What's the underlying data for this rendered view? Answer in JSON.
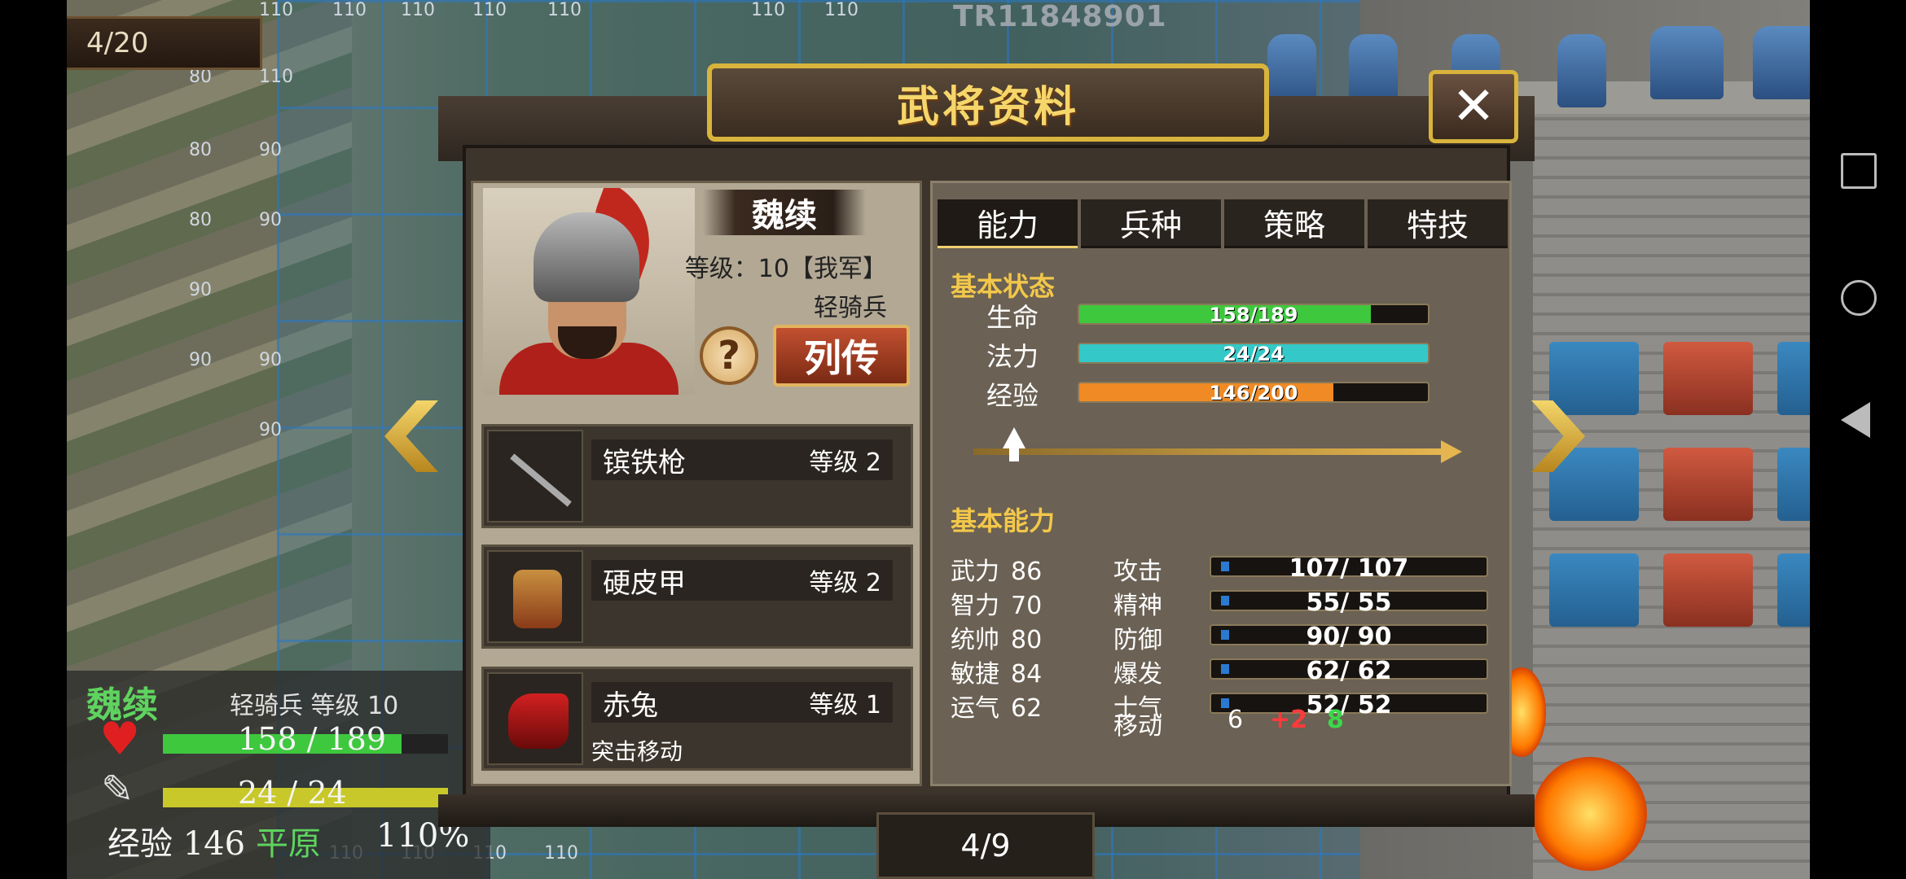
{
  "map": {
    "turn": "4/20",
    "game_id": "TR11848901",
    "grid_costs": [
      "110",
      "110",
      "110",
      "110",
      "110",
      "110",
      "110",
      "80",
      "110",
      "80",
      "90",
      "80",
      "90",
      "90",
      "90",
      "90",
      "90",
      "110",
      "110",
      "110",
      "110"
    ]
  },
  "dialog": {
    "title": "武将资料",
    "close_icon": "close-icon",
    "general": {
      "name": "魏续",
      "level_text": "等级：10【我军】",
      "unit_type": "轻骑兵",
      "help_label": "?",
      "biography_label": "列传"
    },
    "equipment": [
      {
        "name": "镔铁枪",
        "level": "等级 2",
        "note": "",
        "icon": "spear-icon"
      },
      {
        "name": "硬皮甲",
        "level": "等级 2",
        "note": "",
        "icon": "armor-icon"
      },
      {
        "name": "赤兔",
        "level": "等级 1",
        "note": "突击移动",
        "icon": "horse-icon"
      }
    ],
    "tabs": [
      "能力",
      "兵种",
      "策略",
      "特技"
    ],
    "active_tab": "能力",
    "basic_status_title": "基本状态",
    "status": [
      {
        "label": "生命",
        "text": "158/189",
        "current": 158,
        "max": 189,
        "color": "#3ec83e"
      },
      {
        "label": "法力",
        "text": "24/24",
        "current": 24,
        "max": 24,
        "color": "#34c8c8"
      },
      {
        "label": "经验",
        "text": "146/200",
        "current": 146,
        "max": 200,
        "color": "#f08a24"
      }
    ],
    "basic_ability_title": "基本能力",
    "abilities": [
      {
        "label": "武力",
        "value": "86"
      },
      {
        "label": "智力",
        "value": "70"
      },
      {
        "label": "统帅",
        "value": "80"
      },
      {
        "label": "敏捷",
        "value": "84"
      },
      {
        "label": "运气",
        "value": "62"
      }
    ],
    "combat": [
      {
        "label": "攻击",
        "text": "107/ 107"
      },
      {
        "label": "精神",
        "text": "55/ 55"
      },
      {
        "label": "防御",
        "text": "90/ 90"
      },
      {
        "label": "爆发",
        "text": "62/ 62"
      },
      {
        "label": "士气",
        "text": "52/ 52"
      }
    ],
    "move": {
      "label": "移动",
      "base": "6",
      "bonus": "+2",
      "total": "8"
    },
    "page": "4/9"
  },
  "unit_hud": {
    "name": "魏续",
    "info": "轻骑兵 等级 10",
    "hp_text": "158 / 189",
    "hp_current": 158,
    "hp_max": 189,
    "mp_text": "24 / 24",
    "mp_current": 24,
    "mp_max": 24,
    "exp_text": "经验 146",
    "terrain": "平原",
    "terrain_pct": "110%"
  },
  "system_nav": [
    "recent-apps-icon",
    "home-icon",
    "back-icon"
  ]
}
